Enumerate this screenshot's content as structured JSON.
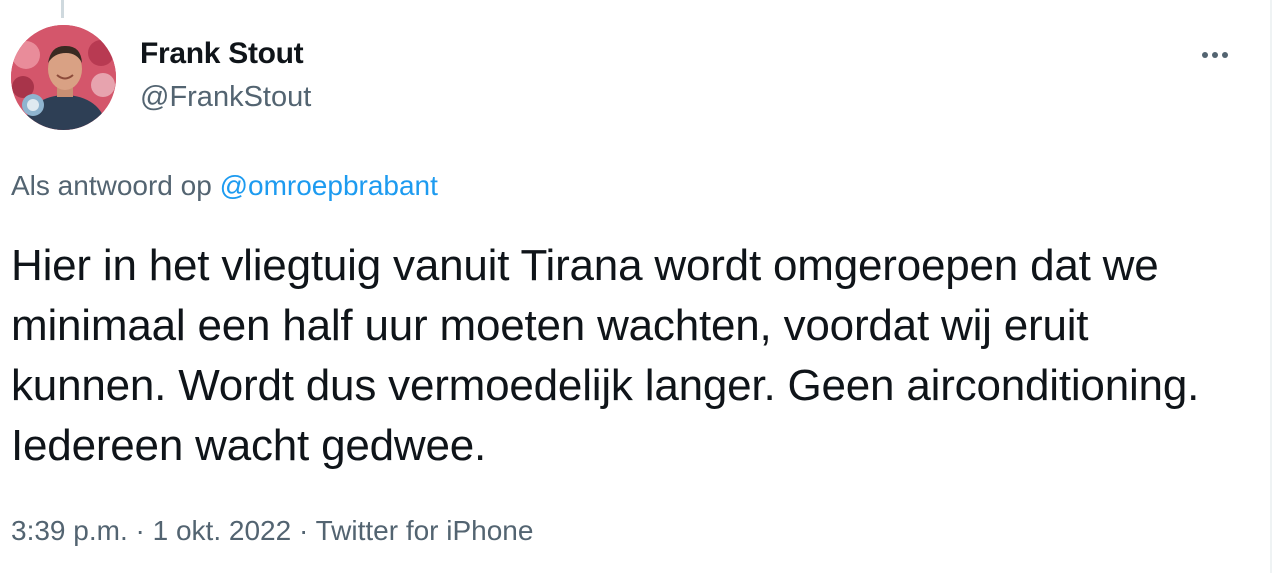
{
  "tweet": {
    "author": {
      "display_name": "Frank Stout",
      "handle": "@FrankStout"
    },
    "reply_context": {
      "prefix": "Als antwoord op ",
      "mention": "@omroepbrabant"
    },
    "text": "Hier in het vliegtuig vanuit Tirana wordt omgeroepen dat we minimaal een half uur moeten wachten, voordat wij eruit kunnen. Wordt dus vermoedelijk langer. Geen airconditioning. Iedereen wacht gedwee.",
    "time": "3:39 p.m.",
    "separator": " · ",
    "date": "1 okt. 2022",
    "source": "Twitter for iPhone"
  },
  "icons": {
    "more": "more-horizontal-icon"
  },
  "colors": {
    "text_primary": "#0f1419",
    "text_secondary": "#536471",
    "link": "#1d9bf0"
  }
}
